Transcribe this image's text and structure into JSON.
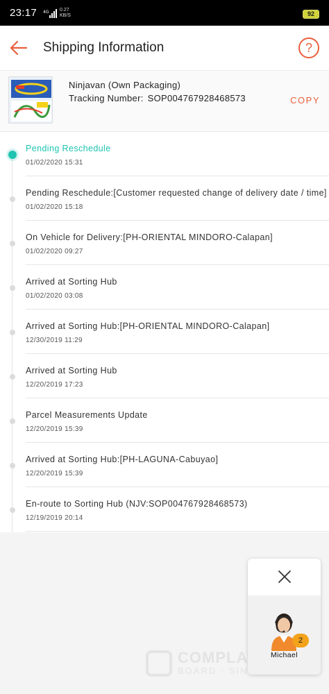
{
  "status_bar": {
    "time": "23:17",
    "network": "4G",
    "speed": "0.27",
    "speed_unit": "KB/S",
    "battery": "92"
  },
  "header": {
    "title": "Shipping Information",
    "help_symbol": "?"
  },
  "shipment": {
    "courier": "Ninjavan (Own Packaging)",
    "tracking_label": "Tracking Number:",
    "tracking_number": "SOP004767928468573",
    "copy_label": "COPY"
  },
  "events": [
    {
      "title": "Pending Reschedule",
      "time": "01/02/2020 15:31",
      "active": true
    },
    {
      "title": "Pending Reschedule:[Customer requested change of delivery date / time]",
      "time": "01/02/2020 15:18"
    },
    {
      "title": "On Vehicle for Delivery:[PH-ORIENTAL MINDORO-Calapan]",
      "time": "01/02/2020 09:27"
    },
    {
      "title": "Arrived at Sorting Hub",
      "time": "01/02/2020 03:08"
    },
    {
      "title": "Arrived at Sorting Hub:[PH-ORIENTAL MINDORO-Calapan]",
      "time": "12/30/2019 11:29"
    },
    {
      "title": "Arrived at Sorting Hub",
      "time": "12/20/2019 17:23"
    },
    {
      "title": "Parcel Measurements Update",
      "time": "12/20/2019 15:39"
    },
    {
      "title": "Arrived at Sorting Hub:[PH-LAGUNA-Cabuyao]",
      "time": "12/20/2019 15:39"
    },
    {
      "title": "En-route to Sorting Hub (NJV:SOP004767928468573)",
      "time": "12/19/2019 20:14"
    }
  ],
  "chat": {
    "agent_name": "Michael",
    "unread_count": "2"
  },
  "watermark": {
    "text": "COMPLAINTS",
    "sub": "BOARD · SINCE 2004"
  },
  "colors": {
    "accent": "#e8603c",
    "active": "#1ec4b0",
    "badge": "#f3a21a"
  },
  "icons": {
    "back": "arrow-left-icon",
    "help": "question-circle-icon",
    "close": "close-icon",
    "signal": "signal-icon",
    "battery": "battery-icon"
  }
}
